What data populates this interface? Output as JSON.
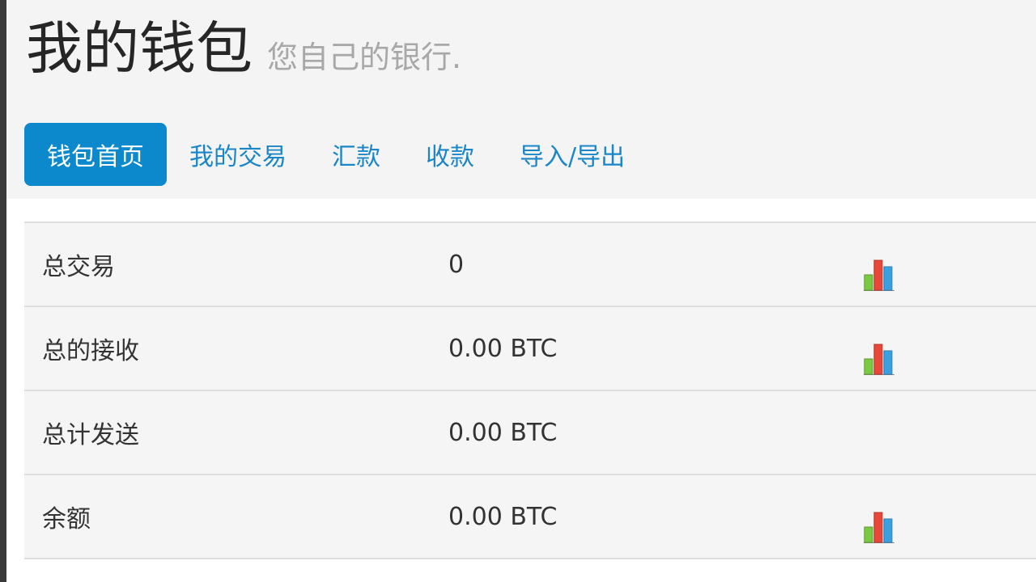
{
  "header": {
    "title": "我的钱包",
    "subtitle": "您自己的银行."
  },
  "nav": {
    "items": [
      {
        "label": "钱包首页",
        "active": true
      },
      {
        "label": "我的交易",
        "active": false
      },
      {
        "label": "汇款",
        "active": false
      },
      {
        "label": "收款",
        "active": false
      },
      {
        "label": "导入/导出",
        "active": false
      }
    ]
  },
  "stats": [
    {
      "label": "总交易",
      "value": "0",
      "has_chart_icon": true
    },
    {
      "label": "总的接收",
      "value": "0.00 BTC",
      "has_chart_icon": true
    },
    {
      "label": "总计发送",
      "value": "0.00 BTC",
      "has_chart_icon": false
    },
    {
      "label": "余额",
      "value": "0.00 BTC",
      "has_chart_icon": true
    }
  ],
  "icons": {
    "chart_icon": "bar-chart-icon"
  },
  "colors": {
    "accent": "#0c88cc",
    "link": "#1a86c8",
    "bar_green": "#7ac943",
    "bar_red": "#e8483a",
    "bar_blue": "#3aa0e0"
  }
}
